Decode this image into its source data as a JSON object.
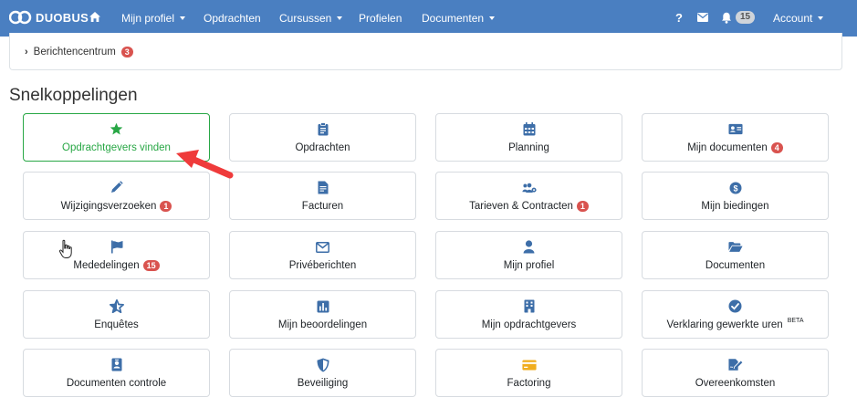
{
  "navbar": {
    "brand": "DUOBUS",
    "home_icon": "home-icon",
    "items": [
      {
        "label": "Mijn profiel",
        "dropdown": true
      },
      {
        "label": "Opdrachten",
        "dropdown": false
      },
      {
        "label": "Cursussen",
        "dropdown": true
      },
      {
        "label": "Profielen",
        "dropdown": false
      },
      {
        "label": "Documenten",
        "dropdown": true
      }
    ],
    "help": "?",
    "notification_count": "15",
    "account_label": "Account",
    "background": "#4a7fc1"
  },
  "messages": {
    "label": "Berichtencentrum",
    "count": "3"
  },
  "quicklinks": {
    "title": "Snelkoppelingen",
    "tiles": [
      {
        "label": "Opdrachtgevers vinden",
        "icon": "star-icon",
        "badge": "",
        "active": true
      },
      {
        "label": "Opdrachten",
        "icon": "clipboard-icon",
        "badge": ""
      },
      {
        "label": "Planning",
        "icon": "calendar-icon",
        "badge": ""
      },
      {
        "label": "Mijn documenten",
        "icon": "id-card-icon",
        "badge": "4"
      },
      {
        "label": "Wijzigingsverzoeken",
        "icon": "pencil-icon",
        "badge": "1"
      },
      {
        "label": "Facturen",
        "icon": "invoice-icon",
        "badge": ""
      },
      {
        "label": "Tarieven & Contracten",
        "icon": "users-cog-icon",
        "badge": "1"
      },
      {
        "label": "Mijn biedingen",
        "icon": "coin-icon",
        "badge": ""
      },
      {
        "label": "Mededelingen",
        "icon": "flag-icon",
        "badge": "15"
      },
      {
        "label": "Privéberichten",
        "icon": "envelope-icon",
        "badge": ""
      },
      {
        "label": "Mijn profiel",
        "icon": "user-icon",
        "badge": ""
      },
      {
        "label": "Documenten",
        "icon": "folder-open-icon",
        "badge": ""
      },
      {
        "label": "Enquêtes",
        "icon": "star-half-icon",
        "badge": ""
      },
      {
        "label": "Mijn beoordelingen",
        "icon": "bar-chart-icon",
        "badge": ""
      },
      {
        "label": "Mijn opdrachtgevers",
        "icon": "building-icon",
        "badge": ""
      },
      {
        "label": "Verklaring gewerkte uren",
        "icon": "check-circle-icon",
        "badge": "",
        "superscript": "BETA"
      },
      {
        "label": "Documenten controle",
        "icon": "user-badge-icon",
        "badge": ""
      },
      {
        "label": "Beveiliging",
        "icon": "shield-icon",
        "badge": ""
      },
      {
        "label": "Factoring",
        "icon": "credit-card-icon",
        "badge": ""
      },
      {
        "label": "Overeenkomsten",
        "icon": "signature-icon",
        "badge": ""
      }
    ]
  },
  "colors": {
    "accent": "#4a7fc1",
    "active_green": "#28a745",
    "badge_red": "#d9534f",
    "factoring_yellow": "#f0ad1e",
    "annotation_arrow": "#ef3b3b"
  }
}
